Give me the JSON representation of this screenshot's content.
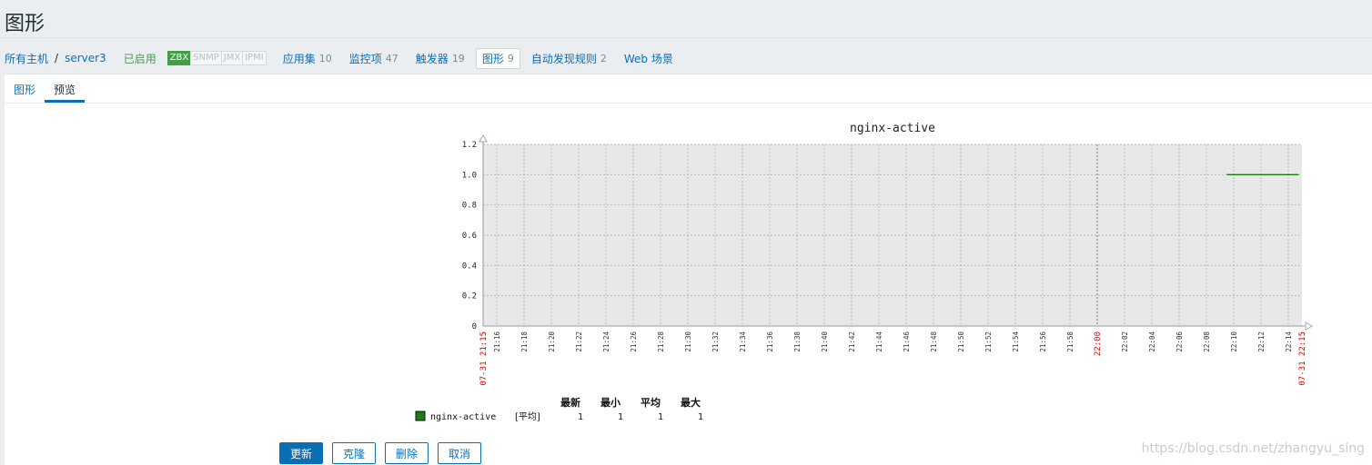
{
  "page": {
    "title": "图形"
  },
  "hostnav": {
    "all_hosts": "所有主机",
    "separator": "/",
    "host": "server3",
    "status": "已启用",
    "availability": [
      "ZBX",
      "SNMP",
      "JMX",
      "IPMI"
    ],
    "applications": {
      "label": "应用集",
      "count": "10"
    },
    "items": {
      "label": "监控项",
      "count": "47"
    },
    "triggers": {
      "label": "触发器",
      "count": "19"
    },
    "graphs": {
      "label": "图形",
      "count": "9"
    },
    "discovery": {
      "label": "自动发现规则",
      "count": "2"
    },
    "web": {
      "label": "Web 场景"
    }
  },
  "tabs": {
    "graph": "图形",
    "preview": "预览"
  },
  "buttons": {
    "update": "更新",
    "clone": "克隆",
    "delete": "删除",
    "cancel": "取消"
  },
  "watermark": "https://blog.csdn.net/zhangyu_sing",
  "colors": {
    "accent": "#0a6eb4",
    "enabled": "#429e47",
    "series": "#1a7c11",
    "date_label": "#dc0000"
  },
  "chart_data": {
    "type": "line",
    "title": "nginx-active",
    "ylim": [
      0,
      1.2
    ],
    "y_ticks": [
      "0",
      "0.2",
      "0.4",
      "0.6",
      "0.8",
      "1.0",
      "1.2"
    ],
    "x_ticks": [
      "07-31 21:15",
      "21:16",
      "21:18",
      "21:20",
      "21:22",
      "21:24",
      "21:26",
      "21:28",
      "21:30",
      "21:32",
      "21:34",
      "21:36",
      "21:38",
      "21:40",
      "21:42",
      "21:44",
      "21:46",
      "21:48",
      "21:50",
      "21:52",
      "21:54",
      "21:56",
      "21:58",
      "22:00",
      "22:02",
      "22:04",
      "22:06",
      "22:08",
      "22:10",
      "22:12",
      "22:14",
      "07-31 22:15"
    ],
    "x_range_minutes": [
      "21:15",
      "22:15"
    ],
    "grid": true,
    "series": [
      {
        "name": "nginx-active",
        "color": "#1a7c11",
        "x": [
          "22:09:30",
          "22:14:45"
        ],
        "values": [
          1,
          1
        ]
      }
    ],
    "legend": {
      "headers": [
        "最新",
        "最小",
        "平均",
        "最大"
      ],
      "rows": [
        {
          "name": "nginx-active",
          "func": "[平均]",
          "last": "1",
          "min": "1",
          "avg": "1",
          "max": "1"
        }
      ]
    }
  }
}
